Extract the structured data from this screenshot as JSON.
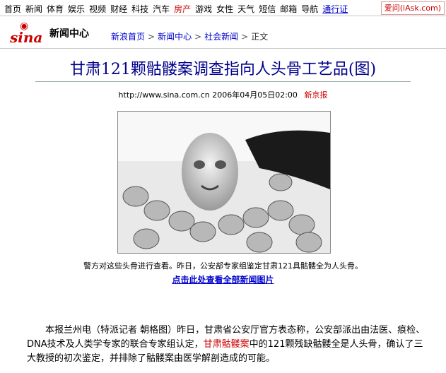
{
  "topnav": {
    "items": [
      "首页",
      "新闻",
      "体育",
      "娱乐",
      "视频",
      "财经",
      "科技",
      "汽车",
      "房产",
      "游戏",
      "女性",
      "天气",
      "短信",
      "邮箱",
      "导航"
    ],
    "highlight_index": 8,
    "pass_link": "通行证",
    "iask": "爱问(iAsk.com)"
  },
  "header": {
    "logo_text": "sina",
    "section_title": "新闻中心",
    "breadcrumbs": [
      "新浪首页",
      "新闻中心",
      "社会新闻",
      "正文"
    ],
    "separator": ">"
  },
  "article": {
    "title": "甘肃121颗骷髅案调查指向人头骨工艺品(图)",
    "url": "http://www.sina.com.cn",
    "datetime": "2006年04月05日02:00",
    "source": "新京报",
    "photo_alt": "photo of skulls being examined",
    "caption": "警方对这些头骨进行查看。昨日，公安部专家组鉴定甘肃121具骷髅全为人头骨。",
    "more_link": "点击此处查看全部新闻图片",
    "body_before": "本报兰州电（特派记者 朝格图）昨日，甘肃省公安厅官方表态称，公安部派出由法医、痕检、DNA技术及人类学专家的联合专家组认定，",
    "body_keyword": "甘肃骷髅案",
    "body_after": "中的121颗残缺骷髅全是人头骨，确认了三大教授的初次鉴定，并排除了骷髅案由医学解剖造成的可能。"
  },
  "colors": {
    "accent": "#cc0000",
    "link": "#0000cc",
    "headline": "#00008b"
  }
}
